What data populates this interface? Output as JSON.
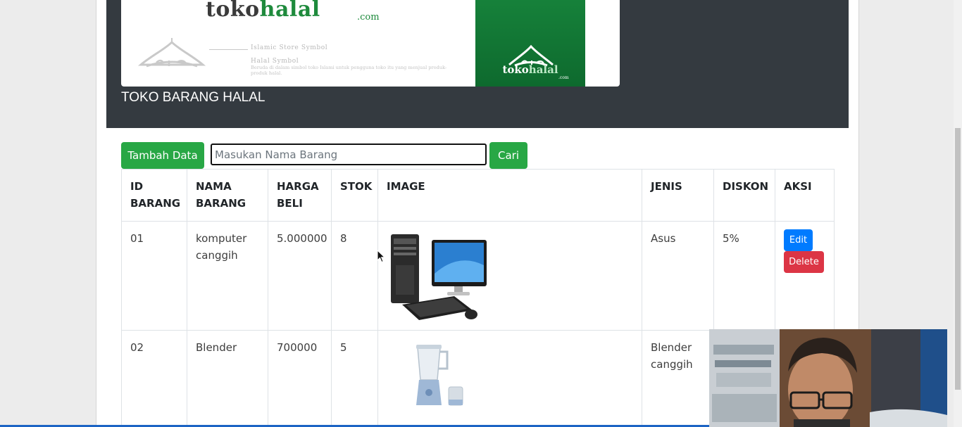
{
  "colors": {
    "header_bg": "#343a40",
    "success": "#28a745",
    "primary": "#007bff",
    "danger": "#dc3545",
    "brand_green": "#1e8a3c"
  },
  "banner": {
    "logo_wordmark_prefix": "toko",
    "logo_wordmark_accent": "halal",
    "logo_domain": ".com",
    "symbol_title": "Islamic Store Symbol",
    "halal_symbol_title": "Halal Symbol",
    "symbol_description": "Beruda di dalam simbol toko Islami untuk pengguna toko itu yang menjual produk-produk halal.",
    "green_wordmark_prefix": "toko",
    "green_wordmark_accent": "halal",
    "green_domain": ".com",
    "store_title": "TOKO BARANG HALAL"
  },
  "toolbar": {
    "add_label": "Tambah Data",
    "search_placeholder": "Masukan Nama Barang",
    "search_value": "",
    "search_button_label": "Cari"
  },
  "table": {
    "headers": [
      "ID BARANG",
      "NAMA BARANG",
      "HARGA BELI",
      "STOK",
      "IMAGE",
      "JENIS",
      "DISKON",
      "AKSI"
    ],
    "rows": [
      {
        "id": "01",
        "nama": "komputer canggih",
        "harga": "5.000000",
        "stok": "8",
        "image": "desktop-computer-image",
        "jenis": "Asus",
        "diskon": "5%",
        "edit_label": "Edit",
        "delete_label": "Delete"
      },
      {
        "id": "02",
        "nama": "Blender",
        "harga": "700000",
        "stok": "5",
        "image": "blender-image",
        "jenis": "Blender canggih",
        "diskon": "",
        "edit_label": "",
        "delete_label": ""
      }
    ]
  }
}
